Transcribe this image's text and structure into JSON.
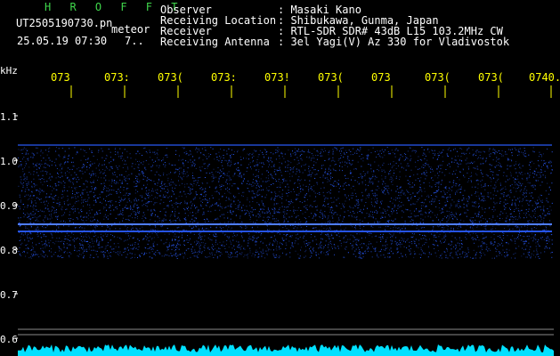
{
  "header": {
    "title": "H R O F F T",
    "filename": "UT2505190730.pn",
    "mode": "meteor",
    "datetime": "25.05.19 07:30",
    "count": "7..",
    "meta": [
      {
        "label": "Observer",
        "value": ": Masaki Kano"
      },
      {
        "label": "Receiving Location",
        "value": ": Shibukawa, Gunma, Japan"
      },
      {
        "label": "Receiver",
        "value": ": RTL-SDR SDR# 43dB L15 103.2MHz CW"
      },
      {
        "label": "Receiving Antenna",
        "value": ": 3el Yagi(V) Az 330 for Vladivostok"
      }
    ]
  },
  "axis": {
    "unit": "kHz",
    "time_ticks": [
      "073",
      "073:",
      "073(",
      "073:",
      "073!",
      "073(",
      "073",
      "073(",
      "073(",
      "0740."
    ],
    "freq_ticks": [
      "1.1",
      "1.0",
      "0.9",
      "0.8",
      "0.7",
      "0.6"
    ]
  },
  "colors": {
    "background": "#000000",
    "title": "#3fd64b",
    "tick_labels": "#ffff00",
    "signal": "#2a5cff",
    "spectrum": "#00e0ff"
  }
}
